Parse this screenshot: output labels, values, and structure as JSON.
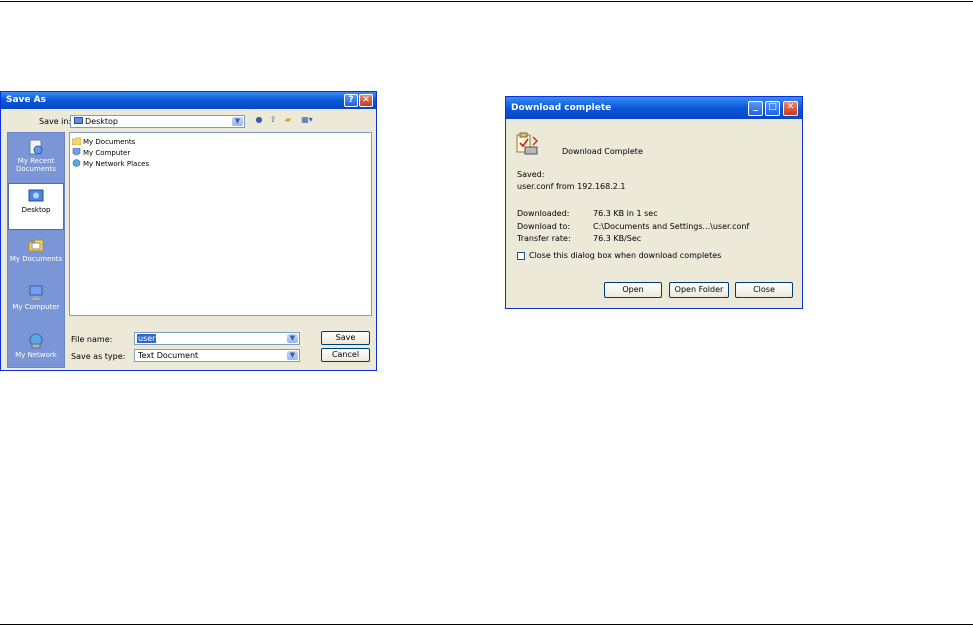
{
  "save_dialog": {
    "title": "Save As",
    "help_glyph": "?",
    "close_glyph": "✕",
    "save_in_label": "Save in:",
    "save_in_value": "Desktop",
    "places": [
      {
        "label": "My Recent Documents",
        "icon": "recent-documents-icon"
      },
      {
        "label": "Desktop",
        "icon": "desktop-icon"
      },
      {
        "label": "My Documents",
        "icon": "my-documents-icon"
      },
      {
        "label": "My Computer",
        "icon": "my-computer-icon"
      },
      {
        "label": "My Network",
        "icon": "my-network-icon"
      }
    ],
    "files": [
      "My Documents",
      "My Computer",
      "My Network Places"
    ],
    "file_name_label": "File name:",
    "file_name_value": "user",
    "save_as_type_label": "Save as type:",
    "save_as_type_value": "Text Document",
    "save_button": "Save",
    "cancel_button": "Cancel"
  },
  "download_dialog": {
    "title": "Download complete",
    "minimize_glyph": "_",
    "maximize_glyph": "□",
    "close_glyph": "✕",
    "heading": "Download Complete",
    "saved_label": "Saved:",
    "saved_value": "user.conf from 192.168.2.1",
    "downloaded_label": "Downloaded:",
    "downloaded_value": "76.3 KB in 1 sec",
    "download_to_label": "Download to:",
    "download_to_value": "C:\\Documents and Settings...\\user.conf",
    "transfer_rate_label": "Transfer rate:",
    "transfer_rate_value": "76.3 KB/Sec",
    "close_checkbox_label": "Close this dialog box when download completes",
    "open_button": "Open",
    "open_folder_button": "Open Folder",
    "close_button": "Close"
  },
  "colors": {
    "titlebar": "#0a58d8",
    "dialog_bg": "#ece9d8",
    "places_bar": "#7b96d6",
    "selection": "#316ac5"
  }
}
